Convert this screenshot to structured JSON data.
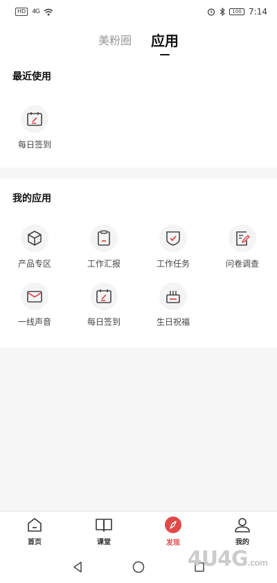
{
  "status_bar": {
    "badge": "HD",
    "signal": "4G",
    "time": "7:14",
    "battery": "100"
  },
  "top_tabs": [
    {
      "label": "美粉圈",
      "active": false
    },
    {
      "label": "应用",
      "active": true
    }
  ],
  "recent": {
    "title": "最近使用",
    "apps": [
      {
        "label": "每日签到",
        "icon": "calendar-check-icon"
      }
    ]
  },
  "mine": {
    "title": "我的应用",
    "apps": [
      {
        "label": "产品专区",
        "icon": "cube-icon"
      },
      {
        "label": "工作汇报",
        "icon": "clipboard-icon"
      },
      {
        "label": "工作任务",
        "icon": "shield-check-icon"
      },
      {
        "label": "问卷调查",
        "icon": "survey-edit-icon"
      },
      {
        "label": "一线声音",
        "icon": "mail-icon"
      },
      {
        "label": "每日签到",
        "icon": "calendar-check-icon"
      },
      {
        "label": "生日祝福",
        "icon": "cake-icon"
      }
    ]
  },
  "bottom_nav": [
    {
      "label": "首页",
      "icon": "home-icon",
      "active": false
    },
    {
      "label": "课堂",
      "icon": "book-icon",
      "active": false
    },
    {
      "label": "发现",
      "icon": "compass-icon",
      "active": true
    },
    {
      "label": "我的",
      "icon": "user-icon",
      "active": false
    }
  ],
  "colors": {
    "accent": "#e04a4a",
    "icon_stroke": "#444444"
  },
  "watermark": {
    "main": "4U4G",
    "suffix": ".com"
  }
}
